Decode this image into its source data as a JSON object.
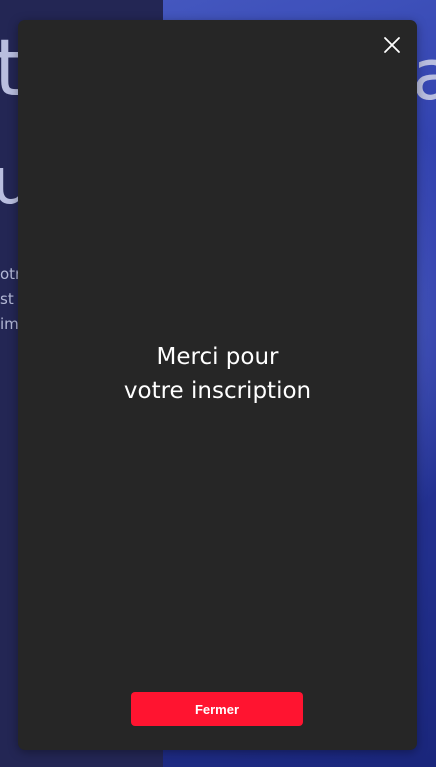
{
  "background": {
    "headline_fragments": [
      "t",
      "u",
      "a"
    ],
    "text_fragments": [
      "otr",
      "st c",
      "im"
    ]
  },
  "modal": {
    "close_icon": "close-icon",
    "message_line1": "Merci pour",
    "message_line2": "votre inscription",
    "button_label": "Fermer"
  },
  "colors": {
    "modal_bg": "#262626",
    "button_bg": "#ff1430",
    "text": "#ffffff"
  }
}
